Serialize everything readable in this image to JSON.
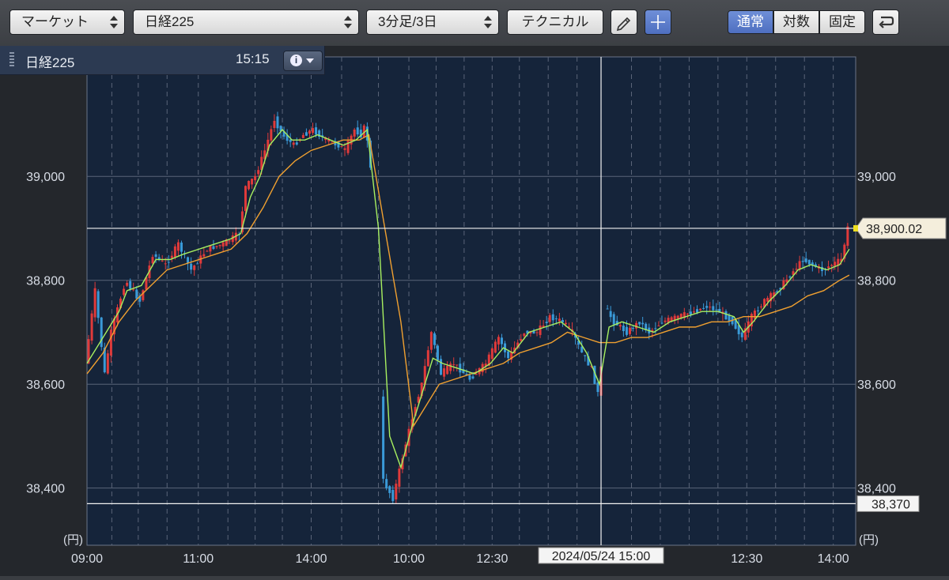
{
  "toolbar": {
    "market_select": "マーケット",
    "symbol_select": "日経225",
    "interval_select": "3分足/3日",
    "technical_button": "テクニカル",
    "scale_options": [
      "通常",
      "対数",
      "固定"
    ],
    "active_scale": "通常"
  },
  "infobox": {
    "name": "日経225",
    "time": "15:15"
  },
  "colors": {
    "up": "#e03a3a",
    "down": "#3a9ad8",
    "ma_short": "#a8f060",
    "ma_long": "#f0a030",
    "background": "#15243a",
    "grid": "#5a6478"
  },
  "chart_data": {
    "type": "candlestick",
    "x_ticks": [
      "09:00",
      "11:00",
      "14:00",
      "10:00",
      "12:30",
      "15:00",
      "12:30",
      "14:00"
    ],
    "y_ticks": [
      "38,400",
      "38,600",
      "38,800",
      "39,000"
    ],
    "y_unit": "(円)",
    "ylim": [
      38290,
      39230
    ],
    "crosshair": {
      "date_label": "2024/05/24 15:00"
    },
    "current_price": {
      "label": "38,900.02",
      "value": 38900.02
    },
    "low_line": {
      "label": "38,370",
      "value": 38370
    },
    "price_path": [
      [
        0,
        38640
      ],
      [
        0.6,
        38780
      ],
      [
        1.2,
        38620
      ],
      [
        1.6,
        38700
      ],
      [
        2.5,
        38800
      ],
      [
        3.4,
        38760
      ],
      [
        4.2,
        38850
      ],
      [
        5.0,
        38830
      ],
      [
        5.8,
        38870
      ],
      [
        6.6,
        38820
      ],
      [
        7.6,
        38860
      ],
      [
        8.6,
        38870
      ],
      [
        9.6,
        38890
      ],
      [
        10.0,
        38980
      ],
      [
        10.6,
        39000
      ],
      [
        11.2,
        39050
      ],
      [
        11.8,
        39110
      ],
      [
        12.3,
        39080
      ],
      [
        13.0,
        39060
      ],
      [
        13.6,
        39080
      ],
      [
        14.2,
        39090
      ],
      [
        15.0,
        39070
      ],
      [
        15.8,
        39060
      ],
      [
        16.2,
        39050
      ],
      [
        16.8,
        39090
      ],
      [
        17.2,
        39080
      ],
      [
        17.5,
        39100
      ],
      [
        18.2,
        38900
      ],
      [
        18.5,
        38420
      ],
      [
        19.2,
        38380
      ],
      [
        19.8,
        38460
      ],
      [
        20.6,
        38560
      ],
      [
        21.0,
        38600
      ],
      [
        21.6,
        38700
      ],
      [
        22.2,
        38620
      ],
      [
        23.0,
        38640
      ],
      [
        24.0,
        38610
      ],
      [
        25.0,
        38640
      ],
      [
        25.8,
        38690
      ],
      [
        26.4,
        38650
      ],
      [
        27.4,
        38700
      ],
      [
        28.2,
        38700
      ],
      [
        29.0,
        38730
      ],
      [
        29.8,
        38720
      ],
      [
        30.4,
        38700
      ],
      [
        31.0,
        38660
      ],
      [
        31.6,
        38630
      ],
      [
        32.1,
        38570
      ],
      [
        32.4,
        38750
      ],
      [
        33.0,
        38720
      ],
      [
        33.8,
        38700
      ],
      [
        34.6,
        38720
      ],
      [
        35.2,
        38700
      ],
      [
        36.0,
        38720
      ],
      [
        37.0,
        38730
      ],
      [
        38.0,
        38740
      ],
      [
        38.8,
        38750
      ],
      [
        39.6,
        38740
      ],
      [
        40.4,
        38720
      ],
      [
        41.0,
        38690
      ],
      [
        41.6,
        38730
      ],
      [
        42.4,
        38760
      ],
      [
        43.2,
        38780
      ],
      [
        44.0,
        38810
      ],
      [
        44.8,
        38840
      ],
      [
        45.4,
        38830
      ],
      [
        46.0,
        38820
      ],
      [
        46.6,
        38830
      ],
      [
        47.2,
        38840
      ],
      [
        47.6,
        38900
      ]
    ],
    "ma_short": [
      [
        0,
        38640
      ],
      [
        1.2,
        38700
      ],
      [
        2.0,
        38740
      ],
      [
        2.5,
        38780
      ],
      [
        3.4,
        38790
      ],
      [
        4.3,
        38840
      ],
      [
        5.2,
        38840
      ],
      [
        6.0,
        38850
      ],
      [
        7.0,
        38860
      ],
      [
        8.0,
        38870
      ],
      [
        9.0,
        38880
      ],
      [
        9.6,
        38890
      ],
      [
        10.2,
        38960
      ],
      [
        10.8,
        39000
      ],
      [
        11.4,
        39060
      ],
      [
        12.2,
        39090
      ],
      [
        12.8,
        39070
      ],
      [
        13.6,
        39070
      ],
      [
        14.4,
        39080
      ],
      [
        15.2,
        39070
      ],
      [
        16.0,
        39060
      ],
      [
        16.8,
        39070
      ],
      [
        17.5,
        39090
      ],
      [
        18.2,
        38900
      ],
      [
        18.9,
        38500
      ],
      [
        19.6,
        38440
      ],
      [
        20.4,
        38530
      ],
      [
        21.0,
        38590
      ],
      [
        21.6,
        38650
      ],
      [
        22.2,
        38640
      ],
      [
        23.2,
        38630
      ],
      [
        24.2,
        38620
      ],
      [
        25.2,
        38640
      ],
      [
        26.0,
        38670
      ],
      [
        26.6,
        38660
      ],
      [
        27.6,
        38700
      ],
      [
        28.6,
        38710
      ],
      [
        29.6,
        38720
      ],
      [
        30.4,
        38700
      ],
      [
        31.2,
        38660
      ],
      [
        32.0,
        38600
      ],
      [
        32.6,
        38710
      ],
      [
        33.4,
        38720
      ],
      [
        34.4,
        38710
      ],
      [
        35.4,
        38700
      ],
      [
        36.4,
        38720
      ],
      [
        37.4,
        38730
      ],
      [
        38.4,
        38740
      ],
      [
        39.4,
        38740
      ],
      [
        40.4,
        38730
      ],
      [
        41.0,
        38700
      ],
      [
        41.6,
        38720
      ],
      [
        42.6,
        38760
      ],
      [
        43.6,
        38790
      ],
      [
        44.4,
        38820
      ],
      [
        45.2,
        38830
      ],
      [
        46.2,
        38820
      ],
      [
        47.0,
        38830
      ],
      [
        47.6,
        38860
      ]
    ],
    "ma_long": [
      [
        0,
        38620
      ],
      [
        1.0,
        38660
      ],
      [
        2.0,
        38720
      ],
      [
        3.0,
        38760
      ],
      [
        4.0,
        38790
      ],
      [
        5.0,
        38820
      ],
      [
        6.0,
        38830
      ],
      [
        7.0,
        38840
      ],
      [
        8.0,
        38850
      ],
      [
        9.0,
        38860
      ],
      [
        10.0,
        38890
      ],
      [
        11.0,
        38940
      ],
      [
        12.0,
        39000
      ],
      [
        13.0,
        39030
      ],
      [
        14.0,
        39050
      ],
      [
        15.0,
        39060
      ],
      [
        16.0,
        39070
      ],
      [
        17.0,
        39070
      ],
      [
        17.6,
        39080
      ],
      [
        18.6,
        38900
      ],
      [
        19.6,
        38720
      ],
      [
        20.4,
        38520
      ],
      [
        21.2,
        38560
      ],
      [
        22.0,
        38600
      ],
      [
        23.0,
        38610
      ],
      [
        24.0,
        38620
      ],
      [
        25.0,
        38630
      ],
      [
        26.0,
        38640
      ],
      [
        27.0,
        38660
      ],
      [
        28.0,
        38670
      ],
      [
        29.0,
        38680
      ],
      [
        30.0,
        38700
      ],
      [
        31.0,
        38690
      ],
      [
        32.0,
        38680
      ],
      [
        33.0,
        38680
      ],
      [
        34.0,
        38690
      ],
      [
        35.0,
        38690
      ],
      [
        36.0,
        38700
      ],
      [
        37.0,
        38710
      ],
      [
        38.0,
        38710
      ],
      [
        39.0,
        38720
      ],
      [
        40.0,
        38720
      ],
      [
        41.0,
        38730
      ],
      [
        42.0,
        38730
      ],
      [
        43.0,
        38740
      ],
      [
        44.0,
        38750
      ],
      [
        45.0,
        38770
      ],
      [
        46.0,
        38780
      ],
      [
        47.0,
        38800
      ],
      [
        47.6,
        38810
      ]
    ]
  }
}
